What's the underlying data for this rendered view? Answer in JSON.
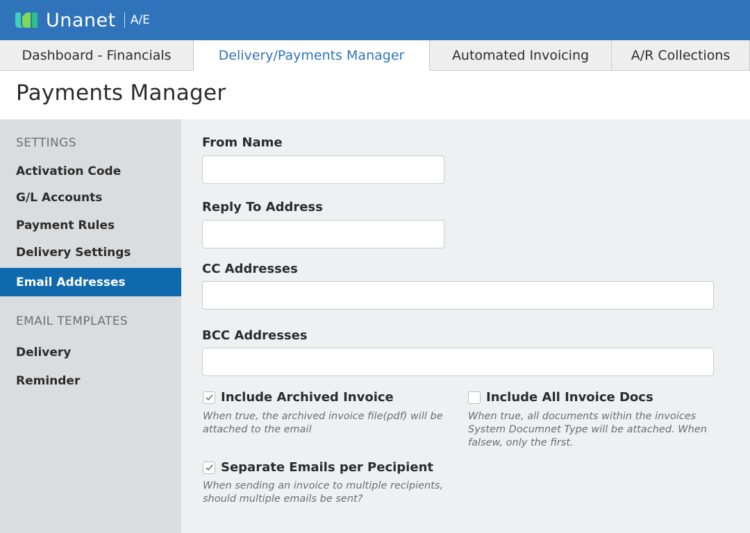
{
  "header": {
    "brand": "Unanet",
    "product": "A/E",
    "accent": "#2f73bb",
    "logo_icon": "unanet-logo-icon"
  },
  "tabs": [
    {
      "label": "Dashboard - Financials",
      "active": false
    },
    {
      "label": "Delivery/Payments Manager",
      "active": true
    },
    {
      "label": "Automated Invoicing",
      "active": false
    },
    {
      "label": "A/R Collections",
      "active": false
    }
  ],
  "page": {
    "title": "Payments Manager"
  },
  "sidebar": {
    "settings_heading": "SETTINGS",
    "settings_items": [
      {
        "label": "Activation Code",
        "active": false
      },
      {
        "label": "G/L Accounts",
        "active": false
      },
      {
        "label": "Payment Rules",
        "active": false
      },
      {
        "label": "Delivery Settings",
        "active": false
      },
      {
        "label": "Email Addresses",
        "active": true
      }
    ],
    "templates_heading": "EMAIL TEMPLATES",
    "template_items": [
      {
        "label": "Delivery"
      },
      {
        "label": "Reminder"
      }
    ],
    "active_color": "#0f6aad"
  },
  "form": {
    "from_name": {
      "label": "From Name",
      "value": "",
      "placeholder": ""
    },
    "reply_to": {
      "label": "Reply To Address",
      "value": "",
      "placeholder": ""
    },
    "cc": {
      "label": "CC Addresses",
      "value": "",
      "placeholder": ""
    },
    "bcc": {
      "label": "BCC Addresses",
      "value": "",
      "placeholder": ""
    },
    "include_archived": {
      "label": "Include Archived Invoice",
      "checked": true,
      "help": "When true, the archived invoice file(pdf) will be attached to the email"
    },
    "include_all_docs": {
      "label": "Include All Invoice Docs",
      "checked": false,
      "help": "When true, all documents within the invoices System Documnet Type will be attached. When falsew, only the first."
    },
    "separate_emails": {
      "label": "Separate Emails per Pecipient",
      "checked": true,
      "help": "When sending an invoice to multiple recipients, should multiple emails be sent?"
    }
  }
}
